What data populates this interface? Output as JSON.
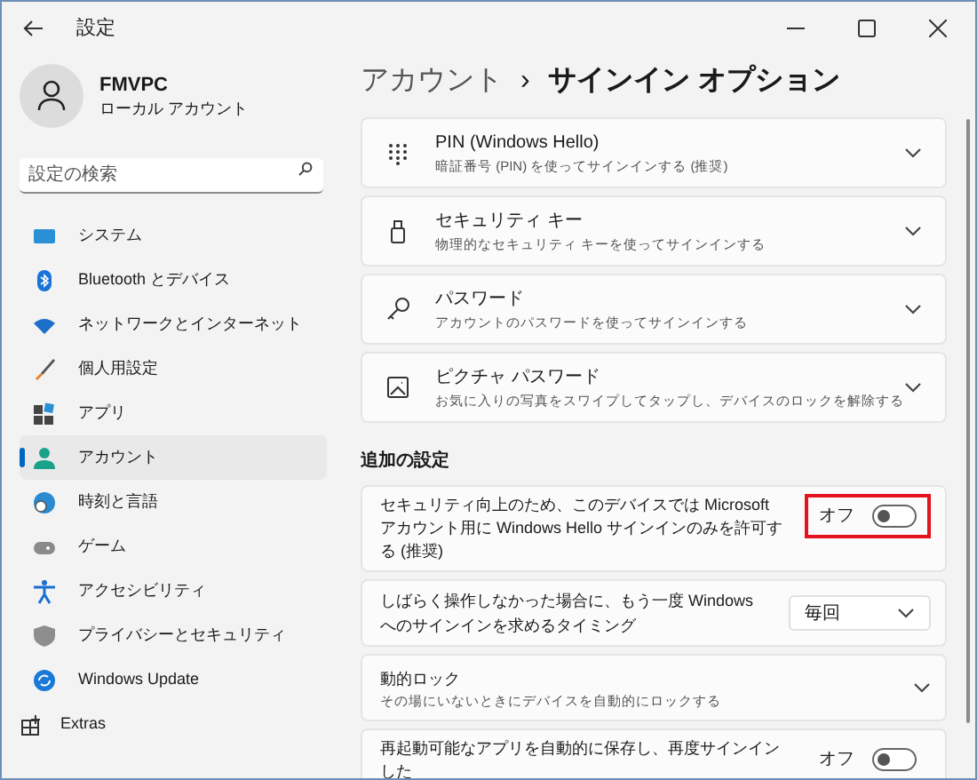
{
  "window": {
    "title": "設定"
  },
  "profile": {
    "name": "FMVPC",
    "account_type": "ローカル アカウント"
  },
  "search": {
    "placeholder": "設定の検索"
  },
  "sidebar": {
    "items": [
      {
        "label": "システム",
        "selected": false
      },
      {
        "label": "Bluetooth とデバイス",
        "selected": false
      },
      {
        "label": "ネットワークとインターネット",
        "selected": false
      },
      {
        "label": "個人用設定",
        "selected": false
      },
      {
        "label": "アプリ",
        "selected": false
      },
      {
        "label": "アカウント",
        "selected": true
      },
      {
        "label": "時刻と言語",
        "selected": false
      },
      {
        "label": "ゲーム",
        "selected": false
      },
      {
        "label": "アクセシビリティ",
        "selected": false
      },
      {
        "label": "プライバシーとセキュリティ",
        "selected": false
      },
      {
        "label": "Windows Update",
        "selected": false
      },
      {
        "label": "Extras",
        "selected": false
      }
    ]
  },
  "breadcrumb": {
    "parent": "アカウント",
    "separator": "›",
    "current": "サインイン オプション"
  },
  "sign_in_methods": [
    {
      "title": "PIN (Windows Hello)",
      "description": "暗証番号 (PIN) を使ってサインインする (推奨)"
    },
    {
      "title": "セキュリティ キー",
      "description": "物理的なセキュリティ キーを使ってサインインする"
    },
    {
      "title": "パスワード",
      "description": "アカウントのパスワードを使ってサインインする"
    },
    {
      "title": "ピクチャ パスワード",
      "description": "お気に入りの写真をスワイプしてタップし、デバイスのロックを解除する"
    }
  ],
  "additional_settings": {
    "heading": "追加の設定",
    "items": [
      {
        "kind": "toggle",
        "label": "セキュリティ向上のため、このデバイスでは Microsoft アカウント用に Windows Hello サインインのみを許可する (推奨)",
        "state_label": "オフ",
        "on": false,
        "highlighted": true
      },
      {
        "kind": "dropdown",
        "label": "しばらく操作しなかった場合に、もう一度 Windows へのサインインを求めるタイミング",
        "value": "毎回"
      },
      {
        "kind": "expand",
        "label": "動的ロック",
        "description": "その場にいないときにデバイスを自動的にロックする"
      },
      {
        "kind": "toggle",
        "label": "再起動可能なアプリを自動的に保存し、再度サインインした",
        "state_label": "オフ",
        "on": false
      }
    ]
  }
}
